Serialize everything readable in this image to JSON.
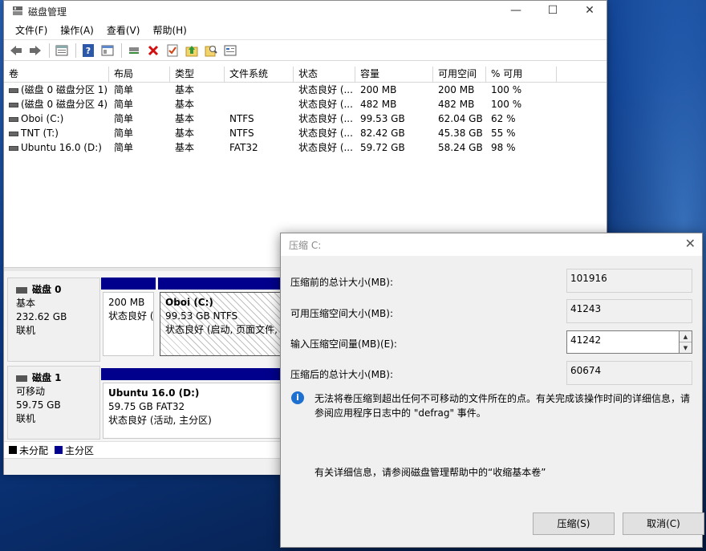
{
  "window": {
    "title": "磁盘管理",
    "controls": {
      "minimize": "—",
      "maximize": "☐",
      "close": "✕"
    }
  },
  "menu": [
    "文件(F)",
    "操作(A)",
    "查看(V)",
    "帮助(H)"
  ],
  "toolbar": [
    "back-icon",
    "forward-icon",
    "properties-icon",
    "help-icon",
    "console-icon",
    "connect-icon",
    "delete-icon",
    "check-icon",
    "up-icon",
    "search-icon",
    "settings-icon"
  ],
  "volume_list": {
    "columns": [
      "卷",
      "布局",
      "类型",
      "文件系统",
      "状态",
      "容量",
      "可用空间",
      "% 可用"
    ],
    "rows": [
      [
        "(磁盘 0 磁盘分区 1)",
        "简单",
        "基本",
        "",
        "状态良好 (...",
        "200 MB",
        "200 MB",
        "100 %"
      ],
      [
        "(磁盘 0 磁盘分区 4)",
        "简单",
        "基本",
        "",
        "状态良好 (...",
        "482 MB",
        "482 MB",
        "100 %"
      ],
      [
        "Oboi (C:)",
        "简单",
        "基本",
        "NTFS",
        "状态良好 (...",
        "99.53 GB",
        "62.04 GB",
        "62 %"
      ],
      [
        "TNT (T:)",
        "简单",
        "基本",
        "NTFS",
        "状态良好 (...",
        "82.42 GB",
        "45.38 GB",
        "55 %"
      ],
      [
        "Ubuntu 16.0 (D:)",
        "简单",
        "基本",
        "FAT32",
        "状态良好 (...",
        "59.72 GB",
        "58.24 GB",
        "98 %"
      ]
    ]
  },
  "disks": [
    {
      "name": "磁盘 0",
      "type": "基本",
      "size": "232.62 GB",
      "state": "联机",
      "partitions": [
        {
          "title": "",
          "size": "200 MB",
          "status": "状态良好 ("
        },
        {
          "title": "Oboi  (C:)",
          "size": "99.53 GB NTFS",
          "status": "状态良好 (启动, 页面文件, 故"
        }
      ]
    },
    {
      "name": "磁盘 1",
      "type": "可移动",
      "size": "59.75 GB",
      "state": "联机",
      "partitions": [
        {
          "title": "Ubuntu 16.0  (D:)",
          "size": "59.75 GB FAT32",
          "status": "状态良好 (活动, 主分区)"
        }
      ]
    }
  ],
  "legend": [
    {
      "label": "未分配",
      "color": "#000000"
    },
    {
      "label": "主分区",
      "color": "#00008c"
    }
  ],
  "dialog": {
    "title": "压缩 C:",
    "close": "✕",
    "fields": [
      {
        "label": "压缩前的总计大小(MB):",
        "value": "101916"
      },
      {
        "label": "可用压缩空间大小(MB):",
        "value": "41243"
      },
      {
        "label": "输入压缩空间量(MB)(E):",
        "value": "41242"
      },
      {
        "label": "压缩后的总计大小(MB):",
        "value": "60674"
      }
    ],
    "info_icon": "i",
    "info_text": "无法将卷压缩到超出任何不可移动的文件所在的点。有关完成该操作时间的详细信息，请参阅应用程序日志中的 \"defrag\" 事件。",
    "help_text": "有关详细信息，请参阅磁盘管理帮助中的“收缩基本卷”",
    "ok_label": "压缩(S)",
    "cancel_label": "取消(C)"
  }
}
